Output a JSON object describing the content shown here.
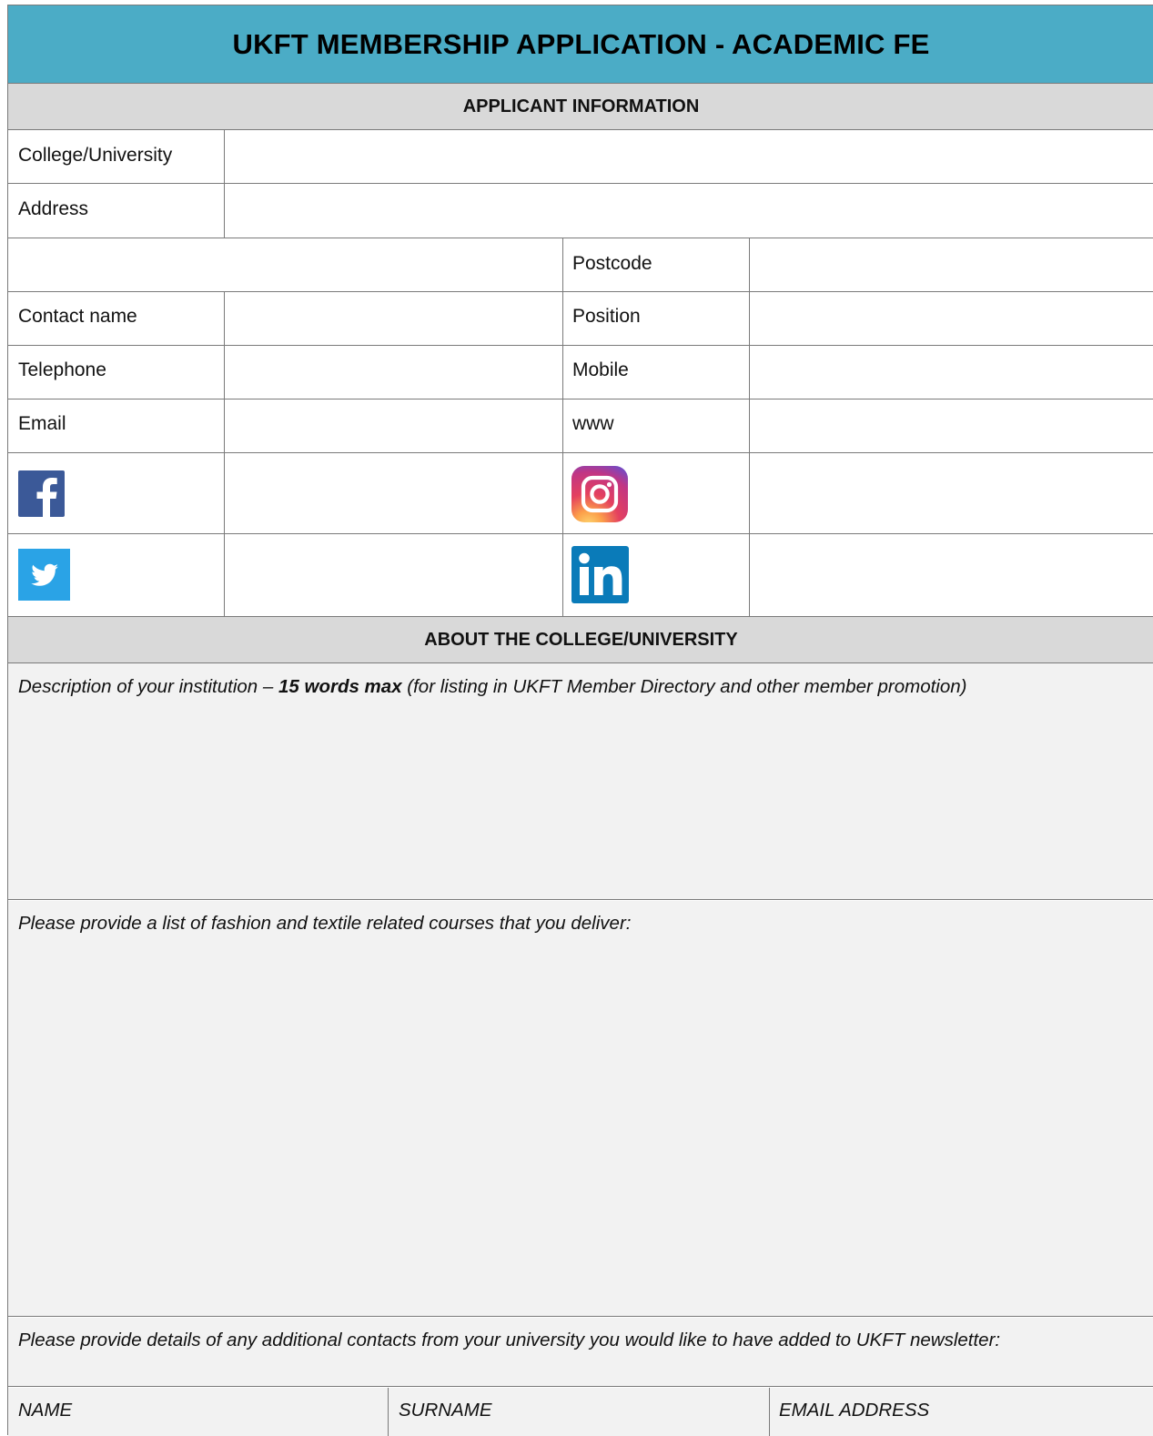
{
  "form": {
    "title": "UKFT MEMBERSHIP APPLICATION - ACADEMIC FE",
    "applicant_section": {
      "heading": "APPLICANT INFORMATION",
      "labels": {
        "college": "College/University",
        "address": "Address",
        "postcode": "Postcode",
        "contact_name": "Contact name",
        "position": "Position",
        "telephone": "Telephone",
        "mobile": "Mobile",
        "email": "Email",
        "www": "www"
      },
      "social_icons": [
        "facebook-icon",
        "instagram-icon",
        "twitter-icon",
        "linkedin-icon"
      ]
    },
    "about_section": {
      "heading": "ABOUT THE COLLEGE/UNIVERSITY",
      "description_prompt_pre": "Description of your institution – ",
      "description_prompt_bold": "15 words max",
      "description_prompt_post": " (for listing in UKFT Member Directory and other member promotion)",
      "courses_prompt": "Please provide a list of fashion and textile related courses that you deliver:",
      "contacts_prompt": "Please provide details of any additional contacts from your university you would like to have added to UKFT newsletter:"
    },
    "contacts_table": {
      "headers": [
        "NAME",
        "SURNAME",
        "EMAIL ADDRESS"
      ]
    }
  },
  "colors": {
    "title_bar": "#4bacc6",
    "section_header": "#d9d9d9",
    "text_area": "#f2f2f2",
    "facebook": "#3b5998",
    "twitter": "#1da1f2",
    "linkedin": "#0077b5"
  }
}
